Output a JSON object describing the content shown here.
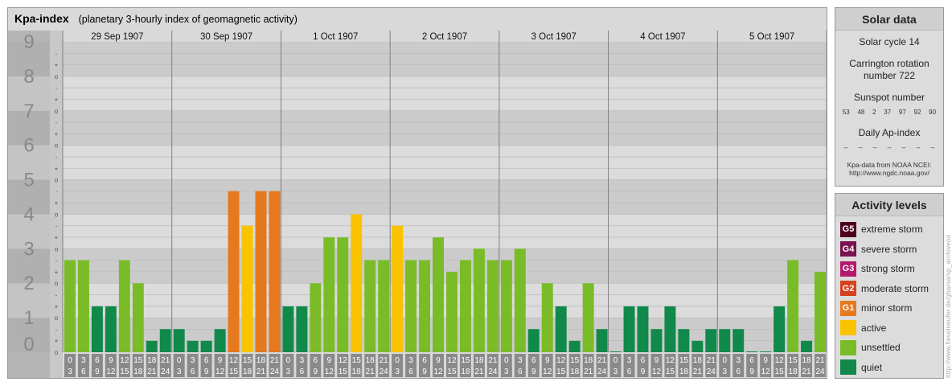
{
  "header": {
    "title": "Kpa-index",
    "subtitle": "(planetary 3-hourly index of geomagnetic activity)"
  },
  "chart_data": {
    "type": "bar",
    "ylim": [
      0,
      9
    ],
    "y_ticks": [
      "0",
      "1",
      "2",
      "3",
      "4",
      "5",
      "6",
      "7",
      "8",
      "9"
    ],
    "y_minor_labels": [
      "o",
      "+",
      "-"
    ],
    "days": [
      "29 Sep 1907",
      "30 Sep 1907",
      "1 Oct 1907",
      "2 Oct 1907",
      "3 Oct 1907",
      "4 Oct 1907",
      "5 Oct 1907"
    ],
    "interval_labels": [
      [
        "0",
        "3"
      ],
      [
        "3",
        "6"
      ],
      [
        "6",
        "9"
      ],
      [
        "9",
        "12"
      ],
      [
        "12",
        "15"
      ],
      [
        "15",
        "18"
      ],
      [
        "18",
        "21"
      ],
      [
        "21",
        "24"
      ]
    ],
    "values": [
      [
        2.67,
        2.67,
        1.33,
        1.33,
        2.67,
        2.0,
        0.33,
        0.67
      ],
      [
        0.67,
        0.33,
        0.33,
        0.67,
        4.67,
        3.67,
        4.67,
        4.67
      ],
      [
        1.33,
        1.33,
        2.0,
        3.33,
        3.33,
        4.0,
        2.67,
        2.67
      ],
      [
        3.67,
        2.67,
        2.67,
        3.33,
        2.33,
        2.67,
        3.0,
        2.67
      ],
      [
        2.67,
        3.0,
        0.67,
        2.0,
        1.33,
        0.33,
        2.0,
        0.67
      ],
      [
        0.0,
        1.33,
        1.33,
        0.67,
        1.33,
        0.67,
        0.33,
        0.67
      ],
      [
        0.67,
        0.67,
        0.0,
        0.0,
        1.33,
        2.67,
        0.33,
        2.33
      ]
    ],
    "colors": {
      "quiet": "#10894a",
      "unsettled": "#7abc28",
      "active": "#f9c300",
      "minor": "#e6781e",
      "moderate": "#d6411e",
      "strong": "#b4186c",
      "severe": "#7a1250",
      "extreme": "#4d0020",
      "band_dark": "#cbcbcb",
      "band_light": "#dcdcdc",
      "axis_bg": "#b5b5b5",
      "axis_text": "#888888",
      "interval_bg": "#8a8a8a"
    }
  },
  "solar_panel": {
    "title": "Solar data",
    "solar_cycle": "Solar cycle 14",
    "carrington": "Carrington rotation number 722",
    "sunspot_label": "Sunspot number",
    "sunspot_values": [
      "53",
      "48",
      "2",
      "37",
      "97",
      "92",
      "90"
    ],
    "ap_label": "Daily Ap-index",
    "ap_values": [
      "--",
      "--",
      "--",
      "--",
      "--",
      "--",
      "--"
    ],
    "credit_line1": "Kpa-data from NOAA NCEI:",
    "credit_line2": "http://www.ngdc.noaa.gov/"
  },
  "levels_panel": {
    "title": "Activity levels",
    "items": [
      {
        "badge": "G5",
        "label": "extreme storm",
        "color": "#4d0020"
      },
      {
        "badge": "G4",
        "label": "severe storm",
        "color": "#7a1250"
      },
      {
        "badge": "G3",
        "label": "strong storm",
        "color": "#b4186c"
      },
      {
        "badge": "G2",
        "label": "moderate storm",
        "color": "#d6411e"
      },
      {
        "badge": "G1",
        "label": "minor storm",
        "color": "#e6781e"
      },
      {
        "badge": "",
        "label": "active",
        "color": "#f9c300"
      },
      {
        "badge": "",
        "label": "unsettled",
        "color": "#7abc28"
      },
      {
        "badge": "",
        "label": "quiet",
        "color": "#10894a"
      }
    ]
  },
  "side_credit": "http://www.fieselneufer.de/gbarsa/sp_archiveoo"
}
